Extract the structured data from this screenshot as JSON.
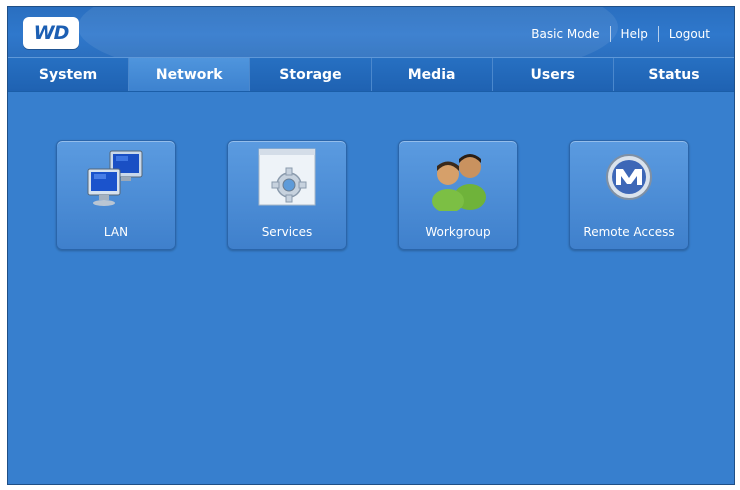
{
  "header": {
    "logo_text": "WD",
    "links": {
      "basic_mode": "Basic Mode",
      "help": "Help",
      "logout": "Logout"
    }
  },
  "nav": {
    "tabs": [
      {
        "label": "System"
      },
      {
        "label": "Network",
        "active": true
      },
      {
        "label": "Storage"
      },
      {
        "label": "Media"
      },
      {
        "label": "Users"
      },
      {
        "label": "Status"
      }
    ]
  },
  "tiles": [
    {
      "label": "LAN",
      "icon": "lan-monitors-icon"
    },
    {
      "label": "Services",
      "icon": "services-gear-icon"
    },
    {
      "label": "Workgroup",
      "icon": "workgroup-users-icon"
    },
    {
      "label": "Remote Access",
      "icon": "remote-access-m-icon"
    }
  ],
  "colors": {
    "background": "#377fce",
    "nav": "#1f62b2",
    "active_tab": "#3d82cf",
    "tile": "#4a8bd5",
    "text": "#ffffff"
  }
}
